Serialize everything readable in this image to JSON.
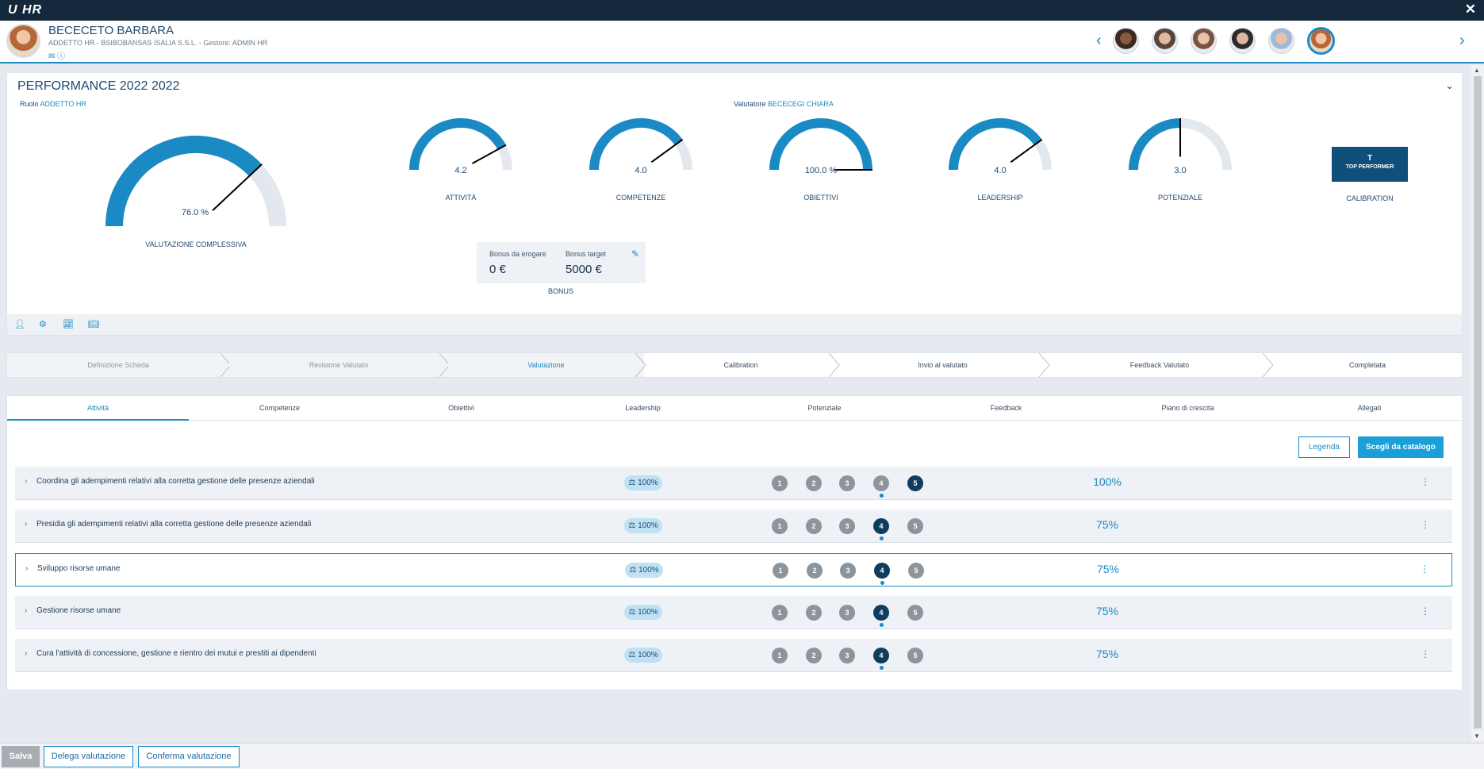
{
  "app": {
    "logo": "U HR"
  },
  "employee": {
    "name": "BECECETO BARBARA",
    "subtitle": "ADDETTO HR - BSIBOBANSAS ISALIA S.S.L. - Gestore: ADMIN HR"
  },
  "performance": {
    "title": "PERFORMANCE 2022 2022",
    "role_label": "Ruolo",
    "role_value": "ADDETTO HR",
    "evaluator_label": "Valutatore",
    "evaluator_value": "BECECEGI CHIARA",
    "overall": {
      "value_text": "76.0 %",
      "fraction": 0.76,
      "label": "VALUTAZIONE COMPLESSIVA"
    },
    "gauges": [
      {
        "value_text": "4.2",
        "fraction": 0.84,
        "label": "ATTIVITÀ"
      },
      {
        "value_text": "4.0",
        "fraction": 0.8,
        "label": "COMPETENZE"
      },
      {
        "value_text": "100.0 %",
        "fraction": 1.0,
        "label": "OBIETTIVI"
      },
      {
        "value_text": "4.0",
        "fraction": 0.8,
        "label": "LEADERSHIP"
      },
      {
        "value_text": "3.0",
        "fraction": 0.5,
        "label": "POTENZIALE"
      }
    ],
    "calibration": {
      "letter": "T",
      "text": "TOP PERFORMER",
      "label": "CALIBRATION"
    },
    "bonus": {
      "to_pay_label": "Bonus da erogare",
      "to_pay_value": "0 €",
      "target_label": "Bonus target",
      "target_value": "5000 €",
      "label": "BONUS"
    }
  },
  "steps": [
    {
      "label": "Definizione Scheda",
      "state": "done"
    },
    {
      "label": "Revisione Valutato",
      "state": "done"
    },
    {
      "label": "Valutazione",
      "state": "active"
    },
    {
      "label": "Calibration",
      "state": "todo"
    },
    {
      "label": "Invio al valutato",
      "state": "todo"
    },
    {
      "label": "Feedback Valutato",
      "state": "todo"
    },
    {
      "label": "Completata",
      "state": "todo"
    }
  ],
  "tabs": [
    "Attività",
    "Competenze",
    "Obiettivi",
    "Leadership",
    "Potenziale",
    "Feedback",
    "Piano di crescita",
    "Allegati"
  ],
  "active_tab": 0,
  "actions": {
    "legend": "Legenda",
    "catalog": "Scegli da catalogo"
  },
  "activities": [
    {
      "title": "Coordina gli adempimenti relativi alla corretta gestione delle presenze aziendali",
      "weight": "100%",
      "rating": 5,
      "expected": 4,
      "score": "100%"
    },
    {
      "title": "Presidia gli adempimenti relativi alla corretta gestione delle presenze aziendali",
      "weight": "100%",
      "rating": 4,
      "expected": 4,
      "score": "75%"
    },
    {
      "title": "Sviluppo risorse umane",
      "weight": "100%",
      "rating": 4,
      "expected": 4,
      "score": "75%"
    },
    {
      "title": "Gestione risorse umane",
      "weight": "100%",
      "rating": 4,
      "expected": 4,
      "score": "75%"
    },
    {
      "title": "Cura l'attività di concessione, gestione e rientro dei mutui e prestiti ai dipendenti",
      "weight": "100%",
      "rating": 4,
      "expected": 4,
      "score": "75%"
    }
  ],
  "footer": {
    "save": "Salva",
    "delegate": "Delega valutazione",
    "confirm": "Conferma valutazione"
  },
  "colors": {
    "accent": "#1a8ac4",
    "gauge_fill": "#1a8ac4",
    "gauge_track": "#e3e8ee",
    "dark": "#0f3d5e"
  }
}
